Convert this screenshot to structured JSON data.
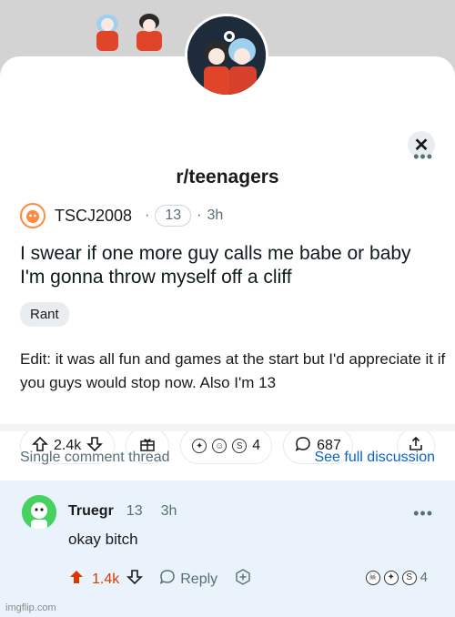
{
  "subreddit": {
    "name": "r/teenagers"
  },
  "post": {
    "author": "TSCJ2008",
    "author_badge": "13",
    "separator": "·",
    "age": "3h",
    "title": "I swear if one more guy calls me babe or baby I'm gonna throw myself off a cliff",
    "flair": "Rant",
    "body": "Edit: it was all fun and games at the start but I'd appreciate it if you guys would stop now. Also I'm 13",
    "upvotes": "2.4k",
    "award_count": "4",
    "comment_count": "687",
    "more_glyph": "•••"
  },
  "thread": {
    "label": "Single comment thread",
    "link": "See full discussion"
  },
  "comment": {
    "author": "Truegr",
    "author_badge": "13",
    "age": "3h",
    "text": "okay bitch",
    "upvotes": "1.4k",
    "reply_label": "Reply",
    "award_count": "4",
    "more_glyph": "•••"
  },
  "close_glyph": "✕",
  "watermark": "imgflip.com",
  "colors": {
    "upvote_active": "#d93a00",
    "link": "#0a64c4",
    "comment_bg": "#eaf2fc",
    "avatar_green": "#46d160"
  }
}
